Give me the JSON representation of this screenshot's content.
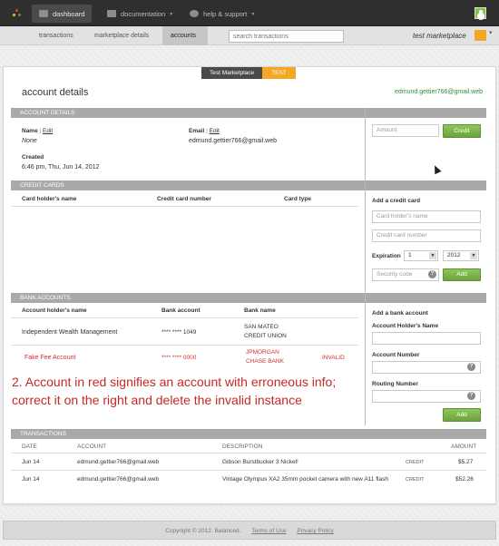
{
  "topbar": {
    "nav": [
      {
        "label": "dashboard",
        "icon": "chart-icon"
      },
      {
        "label": "documentation",
        "icon": "document-icon"
      },
      {
        "label": "help & support",
        "icon": "chat-icon"
      }
    ]
  },
  "subbar": {
    "tabs": [
      "transactions",
      "marketplace details",
      "accounts"
    ],
    "active_tab": "accounts",
    "search_placeholder": "search transactions",
    "marketplace_name": "test marketplace"
  },
  "mode": {
    "live": "Test Marketplace",
    "test": "TEST"
  },
  "page": {
    "title": "account details",
    "email": "edmund.gettier766@gmail.web"
  },
  "account_details": {
    "header": "ACCOUNT DETAILS",
    "name_label": "Name",
    "edit": "Edit",
    "name_value": "None",
    "email_label": "Email",
    "email_value": "edmund.gettier766@gmail.web",
    "created_label": "Created",
    "created_value": "6:46 pm, Thu, Jun 14, 2012",
    "amount_placeholder": "Amount",
    "credit_button": "Credit"
  },
  "credit_cards": {
    "header": "CREDIT CARDS",
    "columns": [
      "Card holder's name",
      "Credit card number",
      "Card type"
    ],
    "add_title": "Add a credit card",
    "holder_placeholder": "Card holder's name",
    "number_placeholder": "Credit card number",
    "expiration_label": "Expiration",
    "exp_month": "1",
    "exp_year": "2012",
    "cvc_placeholder": "Security code",
    "add_button": "Add"
  },
  "bank_accounts": {
    "header": "BANK ACCOUNTS",
    "columns": [
      "Account holder's name",
      "Bank account",
      "Bank name"
    ],
    "rows": [
      {
        "holder": "Independent Wealth Management",
        "account": "**** **** 1049",
        "bank_line1": "SAN MATEO",
        "bank_line2": "CREDIT UNION",
        "status": ""
      },
      {
        "holder": "Fake Fee Account",
        "account": "**** **** 0000",
        "bank_line1": "JPMORGAN",
        "bank_line2": "CHASE BANK",
        "status": "INVALID"
      }
    ],
    "add_title": "Add a bank account",
    "holder_label": "Account Holder's Name",
    "number_label": "Account Number",
    "routing_label": "Routing Number",
    "add_button": "Add"
  },
  "annotation": "2.  Account in red signifies an account with erroneous info; correct it on the right and delete the invalid instance",
  "transactions": {
    "header": "TRANSACTIONS",
    "columns": [
      "DATE",
      "ACCOUNT",
      "DESCRIPTION",
      "AMOUNT"
    ],
    "rows": [
      {
        "date": "Jun 14",
        "account": "edmund.gettier766@gmail.web",
        "description": "Gibson Burstbucker 3 Nickel!",
        "type": "CREDIT",
        "amount": "$5.27"
      },
      {
        "date": "Jun 14",
        "account": "edmund.gettier766@gmail.web",
        "description": "Vintage Olympus XA2 35mm pocket camera with new A11 flash",
        "type": "CREDIT",
        "amount": "$52.26"
      }
    ]
  },
  "footer": {
    "copyright": "Copyright © 2012. Balanced.",
    "terms": "Terms of Use",
    "privacy": "Privacy Policy"
  },
  "colors": {
    "accent_green": "#6ca43c",
    "invalid_red": "#d32f2f",
    "test_orange": "#f5a623"
  }
}
